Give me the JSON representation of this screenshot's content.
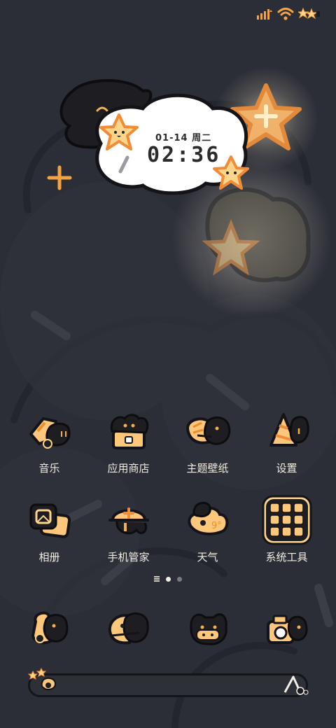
{
  "status_bar": {
    "signal_icon": "signal-bars-icon",
    "wifi_icon": "wifi-icon",
    "battery_icon": "star-battery-icon"
  },
  "clock_widget": {
    "date": "01-14 周二",
    "time": "02:36"
  },
  "apps": [
    {
      "label": "音乐",
      "icon": "music-icon"
    },
    {
      "label": "应用商店",
      "icon": "app-store-icon"
    },
    {
      "label": "主题壁纸",
      "icon": "theme-wallpaper-icon"
    },
    {
      "label": "设置",
      "icon": "settings-icon"
    },
    {
      "label": "相册",
      "icon": "gallery-icon"
    },
    {
      "label": "手机管家",
      "icon": "phone-manager-icon"
    },
    {
      "label": "天气",
      "icon": "weather-icon"
    },
    {
      "label": "系统工具",
      "icon": "system-tools-folder-icon"
    }
  ],
  "page_indicator": {
    "pages": 2,
    "current": 1
  },
  "dock": [
    {
      "icon": "phone-icon"
    },
    {
      "icon": "messages-icon"
    },
    {
      "icon": "browser-icon"
    },
    {
      "icon": "camera-icon"
    }
  ],
  "colors": {
    "background": "#2b2d37",
    "accent_orange": "#f4a340",
    "cream": "#fcd48a",
    "ink": "#1b1b20"
  }
}
